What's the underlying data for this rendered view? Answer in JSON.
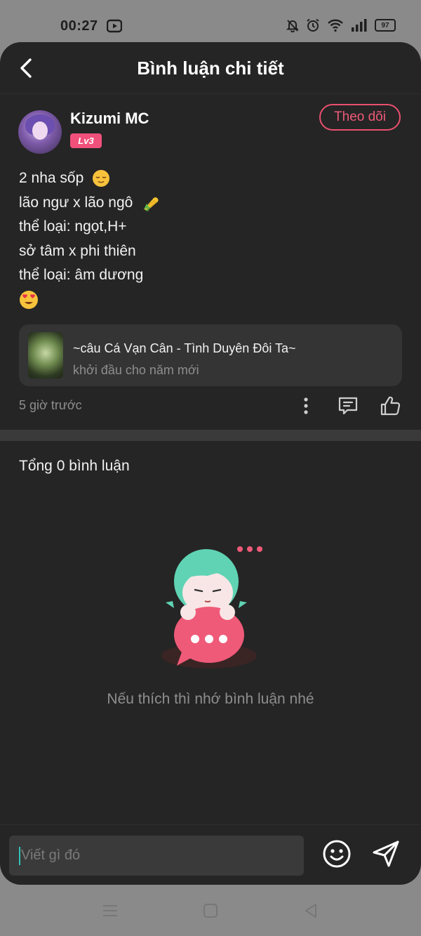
{
  "status_bar": {
    "time": "00:27",
    "battery": "97",
    "icons": [
      "youtube-icon",
      "mute-bell-icon",
      "alarm-icon",
      "wifi-icon",
      "signal-icon",
      "battery-icon"
    ]
  },
  "header": {
    "title": "Bình luận chi tiết",
    "back_icon": "back-arrow-icon"
  },
  "post": {
    "username": "Kizumi MC",
    "level": "Lv3",
    "follow_label": "Theo dõi",
    "lines": [
      "2 nha sốp",
      "lão ngư x lão ngô",
      "thể loại: ngọt,H+",
      "sở tâm x phi thiên",
      "thể loại: âm dương"
    ],
    "song": {
      "title": "~câu Cá Vạn Cân - Tình Duyên Đôi Ta~",
      "subtitle": "khởi đầu cho năm mới"
    },
    "time_ago": "5 giờ trước",
    "actions": [
      "more-vertical-icon",
      "comment-icon",
      "like-icon"
    ]
  },
  "comments": {
    "total_label": "Tổng 0 bình luận",
    "empty_message": "Nếu thích thì nhớ bình luận nhé"
  },
  "composer": {
    "placeholder": "Viết gì đó"
  },
  "colors": {
    "background": "#252525",
    "accent": "#ef5a78",
    "level_badge": "#f0507a",
    "muted_text": "#8e8e8e"
  }
}
